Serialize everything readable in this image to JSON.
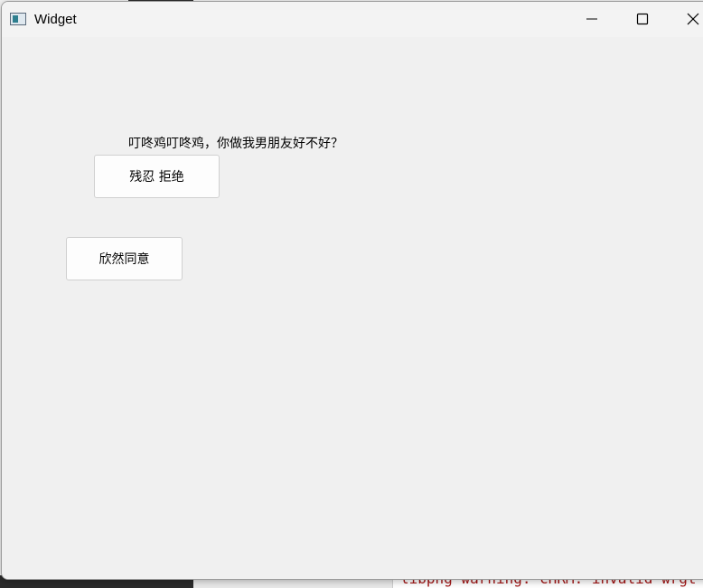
{
  "window": {
    "title": "Widget",
    "controls": {
      "minimize": "minimize-icon",
      "maximize": "maximize-icon",
      "close": "close-icon"
    }
  },
  "content": {
    "question": "叮咚鸡叮咚鸡，你做我男朋友好不好？",
    "reject_button": "残忍 拒绝",
    "accept_button": "欣然同意"
  },
  "background": {
    "editor_text": "libpng warning: cHRM: invalid wrgt"
  },
  "colors": {
    "window_bg": "#f0f0f0",
    "button_bg": "#fdfdfd",
    "button_border": "#d0d0d0"
  }
}
